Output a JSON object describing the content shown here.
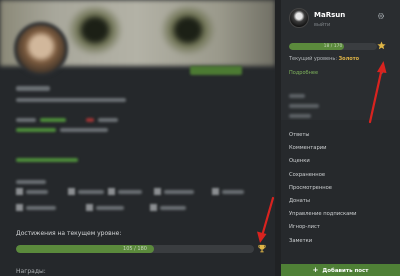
{
  "profile": {
    "achievements_label": "Достижения на текущем уровне:",
    "achievements_progress_text": "105 / 180",
    "achievements_progress": 0.58,
    "rewards_label": "Награды:"
  },
  "sidebar": {
    "user": {
      "name": "MaRsun",
      "logout": "выйти"
    },
    "level_progress_text": "18 / 170",
    "level_progress": 0.62,
    "current_level_label": "Текущий уровень:",
    "current_level_value": "Золото",
    "more_label": "Подробнее",
    "menu": [
      {
        "label": "Ответы"
      },
      {
        "label": "Комментарии"
      },
      {
        "label": "Оценки"
      },
      {
        "label": "Сохраненное"
      },
      {
        "label": "Просмотренное"
      },
      {
        "label": "Донаты"
      },
      {
        "label": "Управление подписками"
      },
      {
        "label": "Игнор-лист"
      },
      {
        "label": "Заметки"
      }
    ],
    "add_post_label": "Добавить пост"
  },
  "icons": {
    "settings": "gear-icon",
    "level": "star-icon",
    "achievements": "trophy-icon",
    "more": "chevron-down-icon",
    "add": "plus-icon"
  },
  "colors": {
    "accent_green": "#5b8a3c",
    "gold": "#e0b646",
    "annotation_red": "#d8231f"
  }
}
